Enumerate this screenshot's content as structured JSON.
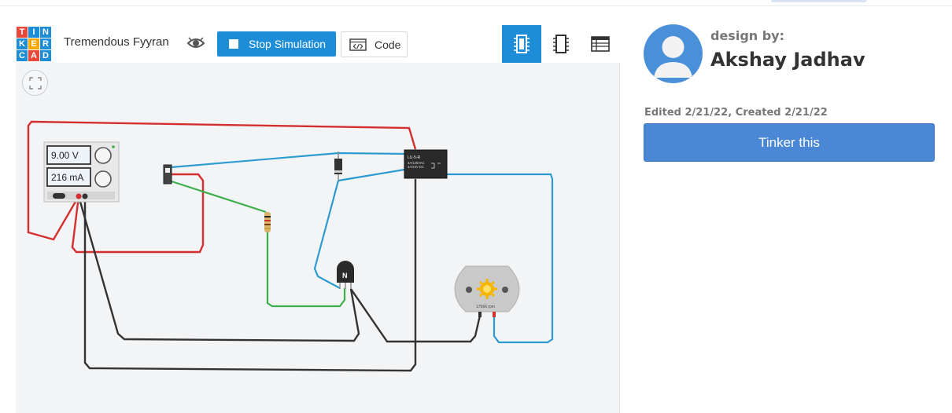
{
  "header": {
    "logo_letters": [
      "T",
      "I",
      "N",
      "K",
      "E",
      "R",
      "C",
      "A",
      "D"
    ],
    "logo_colors": [
      "#e8483a",
      "#1c8dd6",
      "#1c8dd6",
      "#1c8dd6",
      "#f7a700",
      "#1c8dd6",
      "#1c8dd6",
      "#e8483a",
      "#1c8dd6"
    ],
    "project_title": "Tremendous Fyyran",
    "stop_simulation_label": "Stop Simulation",
    "code_label": "Code",
    "view_tabs": [
      {
        "icon": "component-view-icon",
        "active": true
      },
      {
        "icon": "schematic-view-icon",
        "active": false
      },
      {
        "icon": "component-list-icon",
        "active": false
      }
    ]
  },
  "circuit": {
    "power_supply": {
      "voltage": "9.00 V",
      "current": "216 mA"
    },
    "relay_label": "LU-5-R",
    "relay_spec_1": "3A/125VAC",
    "relay_spec_2": "3A/24V DC",
    "transistor_label": "N",
    "motor_rpm": "17566 rpm"
  },
  "sidebar": {
    "design_by_label": "design by:",
    "designer_name": "Akshay Jadhav",
    "dates": "Edited 2/21/22, Created 2/21/22",
    "tinker_button_label": "Tinker this"
  },
  "colors": {
    "accent": "#1c8dd6",
    "tinker_button": "#4a87d4",
    "wire_red": "#d32f2f",
    "wire_blue": "#2b9bd1",
    "wire_green": "#3cae4a",
    "wire_black": "#333333"
  }
}
